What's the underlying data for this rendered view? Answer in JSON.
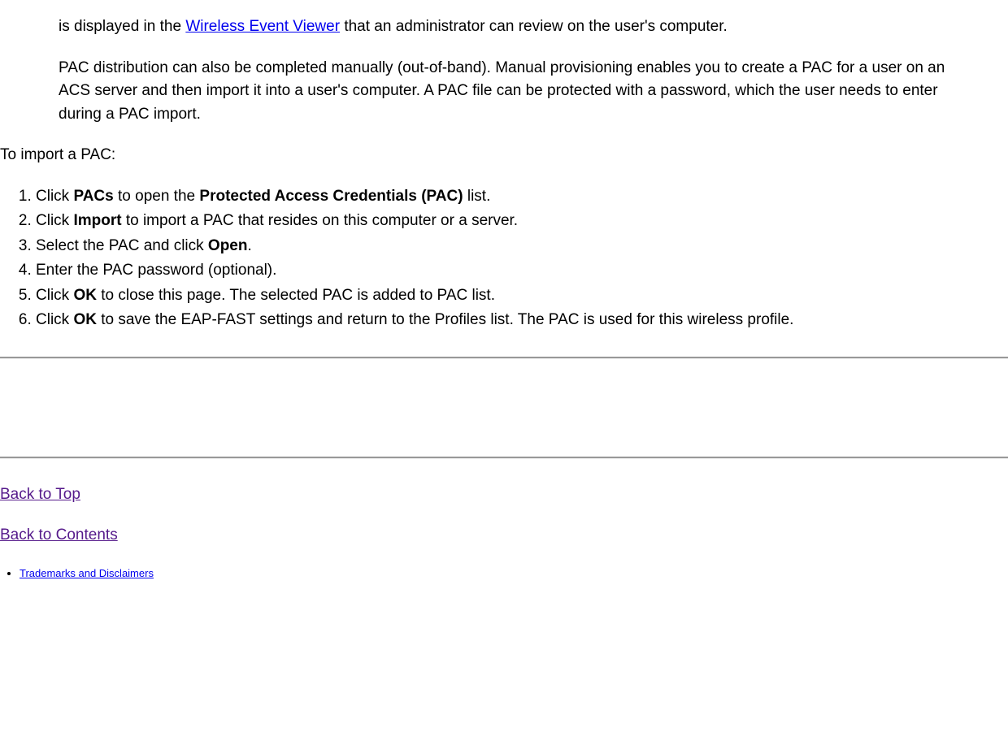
{
  "para1_pre": "is displayed in the ",
  "para1_link": "Wireless Event Viewer",
  "para1_post": " that an administrator can review on the user's computer.",
  "para2": "PAC distribution can also be completed manually (out-of-band). Manual provisioning enables you to create a PAC for a user on an ACS server and then import it into a user's computer. A PAC file can be protected with a password, which the user needs to enter during a PAC import.",
  "intro": "To import a PAC:",
  "steps": {
    "s1_pre": "Click ",
    "s1_b1": "PACs",
    "s1_mid": " to open the ",
    "s1_b2": "Protected Access Credentials (PAC)",
    "s1_post": " list.",
    "s2_pre": "Click ",
    "s2_b": "Import",
    "s2_post": " to import a PAC that resides on this computer or a server.",
    "s3_pre": "Select the PAC and click ",
    "s3_b": "Open",
    "s3_post": ".",
    "s4": "Enter the PAC password (optional).",
    "s5_pre": "Click ",
    "s5_b": "OK",
    "s5_post": " to close this page. The selected PAC is added to PAC list.",
    "s6_pre": "Click ",
    "s6_b": "OK",
    "s6_post": " to save the EAP-FAST settings and return to the Profiles list. The PAC is used for this wireless profile."
  },
  "nav": {
    "back_to_top": "Back to Top",
    "back_to_contents": "Back to Contents",
    "trademarks": "Trademarks and Disclaimers"
  }
}
